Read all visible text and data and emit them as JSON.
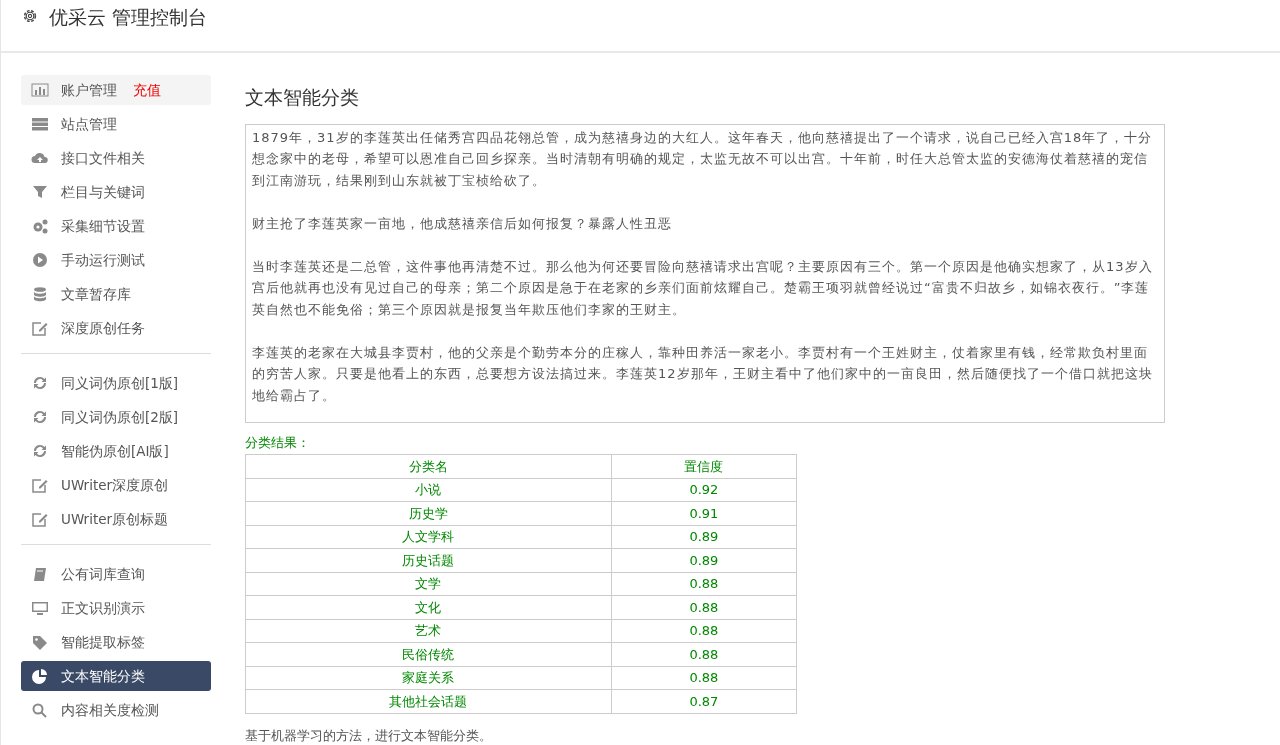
{
  "header": {
    "title": "优采云 管理控制台"
  },
  "sidebar": {
    "groups": [
      [
        {
          "label": "账户管理",
          "badge": "充值",
          "selected": false,
          "hover": true
        },
        {
          "label": "站点管理",
          "selected": false
        },
        {
          "label": "接口文件相关",
          "selected": false
        },
        {
          "label": "栏目与关键词",
          "selected": false
        },
        {
          "label": "采集细节设置",
          "selected": false
        },
        {
          "label": "手动运行测试",
          "selected": false
        },
        {
          "label": "文章暂存库",
          "selected": false
        },
        {
          "label": "深度原创任务",
          "selected": false
        }
      ],
      [
        {
          "label": "同义词伪原创[1版]",
          "selected": false
        },
        {
          "label": "同义词伪原创[2版]",
          "selected": false
        },
        {
          "label": "智能伪原创[AI版]",
          "selected": false
        },
        {
          "label": "UWriter深度原创",
          "selected": false
        },
        {
          "label": "UWriter原创标题",
          "selected": false
        }
      ],
      [
        {
          "label": "公有词库查询",
          "selected": false
        },
        {
          "label": "正文识别演示",
          "selected": false
        },
        {
          "label": "智能提取标签",
          "selected": false
        },
        {
          "label": "文本智能分类",
          "selected": true
        },
        {
          "label": "内容相关度检测",
          "selected": false
        }
      ]
    ]
  },
  "main": {
    "title": "文本智能分类",
    "text_input": {
      "paragraphs": [
        "1879年，31岁的李莲英出任储秀宫四品花翎总管，成为慈禧身边的大红人。这年春天，他向慈禧提出了一个请求，说自己已经入宫18年了，十分想念家中的老母，希望可以恩准自己回乡探亲。当时清朝有明确的规定，太监无故不可以出宫。十年前，时任大总管太监的安德海仗着慈禧的宠信到江南游玩，结果刚到山东就被丁宝桢给砍了。",
        "财主抢了李莲英家一亩地，他成慈禧亲信后如何报复？暴露人性丑恶",
        "当时李莲英还是二总管，这件事他再清楚不过。那么他为何还要冒险向慈禧请求出宫呢？主要原因有三个。第一个原因是他确实想家了，从13岁入宫后他就再也没有见过自己的母亲；第二个原因是急于在老家的乡亲们面前炫耀自己。楚霸王项羽就曾经说过“富贵不归故乡，如锦衣夜行。”李莲英自然也不能免俗；第三个原因就是报复当年欺压他们李家的王财主。",
        "李莲英的老家在大城县李贾村，他的父亲是个勤劳本分的庄稼人，靠种田养活一家老小。李贾村有一个王姓财主，仗着家里有钱，经常欺负村里面的穷苦人家。只要是他看上的东西，总要想方设法搞过来。李莲英12岁那年，王财主看中了他们家中的一亩良田，然后随便找了一个借口就把这块地给霸占了。"
      ]
    },
    "result_label": "分类结果：",
    "table": {
      "columns": [
        "分类名",
        "置信度"
      ],
      "rows": [
        [
          "小说",
          "0.92"
        ],
        [
          "历史学",
          "0.91"
        ],
        [
          "人文学科",
          "0.89"
        ],
        [
          "历史话题",
          "0.89"
        ],
        [
          "文学",
          "0.88"
        ],
        [
          "文化",
          "0.88"
        ],
        [
          "艺术",
          "0.88"
        ],
        [
          "民俗传统",
          "0.88"
        ],
        [
          "家庭关系",
          "0.88"
        ],
        [
          "其他社会话题",
          "0.87"
        ]
      ]
    },
    "footnote": "基于机器学习的方法，进行文本智能分类。"
  }
}
